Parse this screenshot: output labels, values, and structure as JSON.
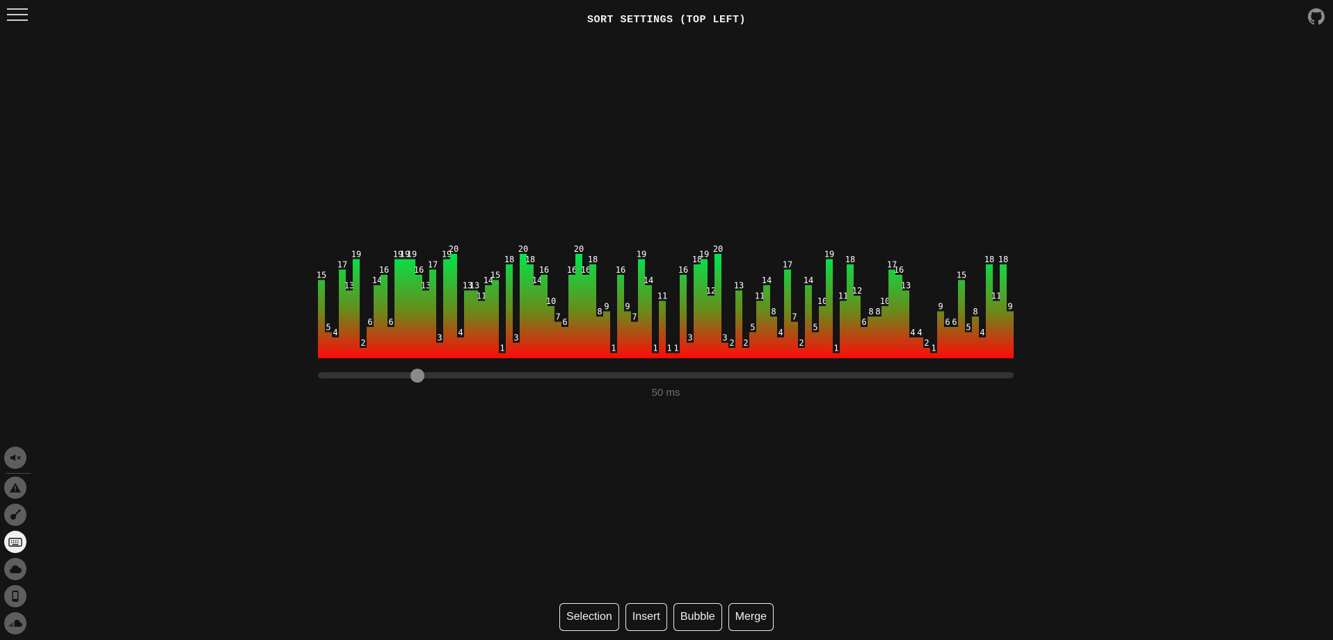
{
  "header": {
    "title": "SORT SETTINGS (TOP LEFT)"
  },
  "icons": {
    "menu": "hamburger-menu-icon",
    "github": "github-icon"
  },
  "slider": {
    "value_ms": 50,
    "min_ms": 0,
    "max_ms": 500,
    "label": "50 ms"
  },
  "sidebar": {
    "items": [
      {
        "name": "mute",
        "icon": "volume-mute-icon",
        "active": false
      },
      {
        "name": "warning",
        "icon": "warning-icon",
        "active": false
      },
      {
        "name": "guitar",
        "icon": "guitar-icon",
        "active": false
      },
      {
        "name": "keyboard",
        "icon": "keyboard-icon",
        "active": true
      },
      {
        "name": "cloud",
        "icon": "cloud-icon",
        "active": false
      },
      {
        "name": "phone",
        "icon": "phone-icon",
        "active": false
      },
      {
        "name": "soundcloud",
        "icon": "soundcloud-icon",
        "active": false
      }
    ]
  },
  "buttons": {
    "selection": "Selection",
    "insert": "Insert",
    "bubble": "Bubble",
    "merge": "Merge"
  },
  "colors": {
    "background": "#141414",
    "bar_top": "#00e64d",
    "bar_bottom": "#ff0a0a",
    "slider_thumb": "#8a8a8a"
  },
  "chart_data": {
    "type": "bar",
    "ylim": [
      0,
      20
    ],
    "values": [
      15,
      5,
      4,
      17,
      13,
      19,
      2,
      6,
      14,
      16,
      6,
      19,
      19,
      19,
      16,
      13,
      17,
      3,
      19,
      20,
      4,
      13,
      13,
      11,
      14,
      15,
      1,
      18,
      3,
      20,
      18,
      14,
      16,
      10,
      7,
      6,
      16,
      20,
      16,
      18,
      8,
      9,
      1,
      16,
      9,
      7,
      19,
      14,
      1,
      11,
      1,
      1,
      16,
      3,
      18,
      19,
      12,
      20,
      3,
      2,
      13,
      2,
      5,
      11,
      14,
      8,
      4,
      17,
      7,
      2,
      14,
      5,
      10,
      19,
      1,
      11,
      18,
      12,
      6,
      8,
      8,
      10,
      17,
      16,
      13,
      4,
      4,
      2,
      1,
      9,
      6,
      6,
      15,
      5,
      8,
      4,
      18,
      11,
      18,
      9
    ]
  }
}
